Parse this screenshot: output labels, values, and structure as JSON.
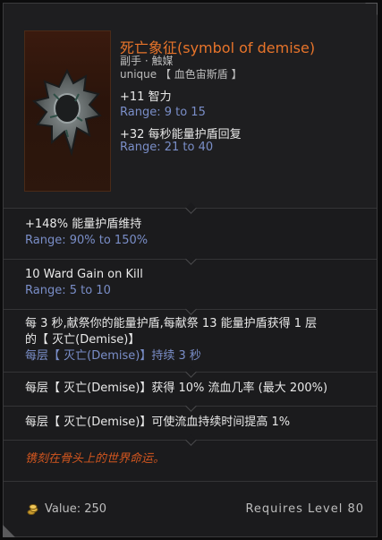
{
  "item": {
    "name": "死亡象征(symbol of demise)",
    "slot": "副手 · 触媒",
    "rarity": "unique 【 血色宙斯盾 】",
    "icon": "spiked-ring-icon",
    "header_mods": [
      {
        "stat": "+11 智力",
        "range": "Range: 9 to 15"
      },
      {
        "stat": "+32 每秒能量护盾回复",
        "range": "Range: 21 to 40"
      }
    ],
    "mods": [
      {
        "lines": [
          "+148% 能量护盾维持"
        ],
        "range": "Range: 90% to 150%"
      },
      {
        "lines": [
          "10 Ward Gain on Kill"
        ],
        "range": "Range: 5 to 10"
      }
    ],
    "unique_effects": [
      {
        "lines": [
          "每 3 秒,献祭你的能量护盾,每献祭 13 能量护盾获得 1 层",
          "的【 灭亡(Demise)】"
        ],
        "range": "每层【 灭亡(Demise)】持续 3 秒"
      },
      {
        "lines": [
          "每层【 灭亡(Demise)】获得 10% 流血几率 (最大 200%)"
        ]
      },
      {
        "lines": [
          "每层【 灭亡(Demise)】可使流血持续时间提高 1%"
        ]
      }
    ],
    "flavor": "镌刻在骨头上的世界命运。",
    "value_label": "Value: 250",
    "requires": "Requires Level 80"
  },
  "colors": {
    "unique_title": "#e8742a",
    "range_blue": "#7a8ec8",
    "flavor": "#d2561f"
  }
}
